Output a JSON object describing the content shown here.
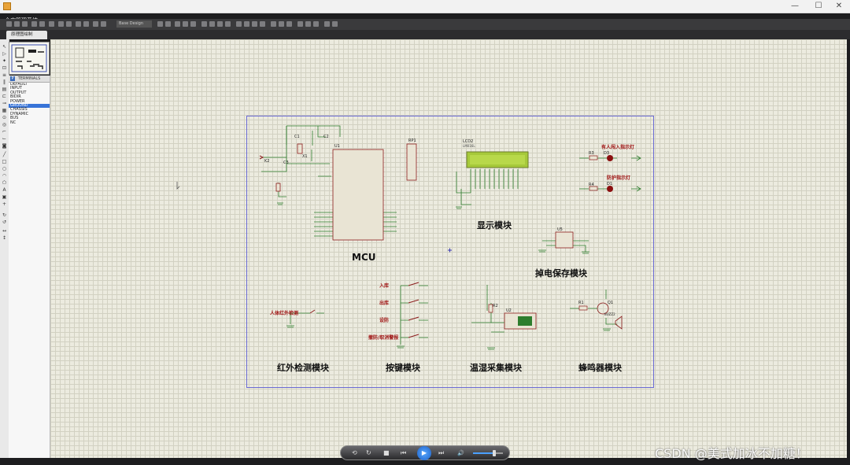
{
  "window": {
    "title": "仓库管理系统",
    "controls": [
      "—",
      "☐",
      "✕"
    ]
  },
  "toolbar": {
    "design_combo": "Base Design"
  },
  "tab": {
    "label": "原理图绘制"
  },
  "terminals": {
    "header": "TERMINALS",
    "p_button": "P",
    "items": [
      "DEFAULT",
      "INPUT",
      "OUTPUT",
      "BIDIR",
      "POWER",
      "GROUND",
      "CHASSIS",
      "DYNAMIC",
      "BUS",
      "NC"
    ],
    "selected_index": 5
  },
  "schematic": {
    "module_labels": {
      "mcu": "MCU",
      "display": "显示模块",
      "power_save": "掉电保存模块",
      "ir": "红外检测模块",
      "keys": "按键模块",
      "temp_humidity": "温湿采集模块",
      "buzzer": "蜂鸣器模块"
    },
    "signal_labels": {
      "inbound": "入库",
      "outbound": "出库",
      "setting": "设防",
      "arm_disarm": "撤防/取消警报",
      "ir_detect": "人体红外检测",
      "led_person": "有人闯入指示灯",
      "led_guard": "防护指示灯"
    },
    "components": {
      "u1": "U1",
      "lcd": "LCD2",
      "lcd_model": "LM016L",
      "rp1": "RP1",
      "c1": "C1",
      "c2": "C2",
      "c3": "C3",
      "x1": "X1",
      "k2": "K2",
      "d3": "D3",
      "d1": "D1",
      "r3": "R3",
      "r4": "R4",
      "u5": "U5",
      "u2": "U2",
      "r2": "R2",
      "q1": "Q1",
      "r1": "R1",
      "buzz": "BUZZ2"
    }
  },
  "player": {
    "buttons": [
      "⟲",
      "↻",
      "■",
      "⏮",
      "▶",
      "⏭",
      "🔊"
    ],
    "volume": 0.7
  },
  "watermark": "CSDN @美式加冰不加糖！"
}
